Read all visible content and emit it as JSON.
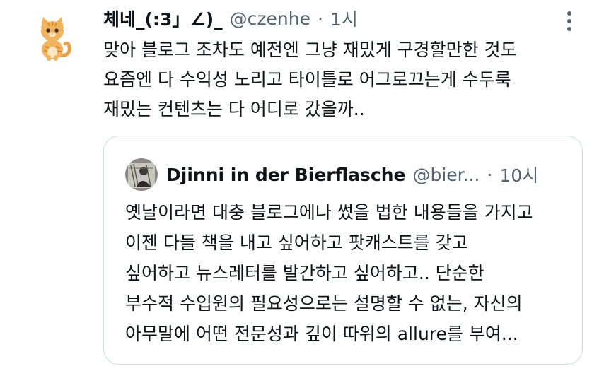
{
  "tweet": {
    "display_name": "체네_(:3」∠)_",
    "handle": "@czenhe",
    "separator": "·",
    "time": "1시",
    "avatar_icon": "orange-tabby-cat-icon",
    "lines": [
      "맞아 블로그 조차도 예전엔 그냥 재밌게 구경할만한 것도",
      "요즘엔 다 수익성 노리고 타이틀로 어그로끄는게 수두룩",
      "재밌는 컨텐츠는 다 어디로 갔을까.."
    ]
  },
  "quote": {
    "display_name": "Djinni in der Bierflasche",
    "handle": "@bier...",
    "separator": "·",
    "time": "10시",
    "avatar_icon": "sketch-portrait-icon",
    "lines": [
      "옛날이라면 대충 블로그에나 썼을 법한 내용들을 가지고",
      "이젠 다들 책을 내고 싶어하고 팟캐스트를 갖고",
      "싶어하고 뉴스레터를 발간하고 싶어하고.. 단순한",
      "부수적 수입원의 필요성으로는 설명할 수 없는, 자신의",
      "아무말에 어떤 전문성과 깊이 따위의 allure를 부여..."
    ]
  },
  "colors": {
    "text": "#0f1419",
    "secondary": "#536471",
    "border": "#cfd9de"
  },
  "more_icon": "more-options-icon"
}
